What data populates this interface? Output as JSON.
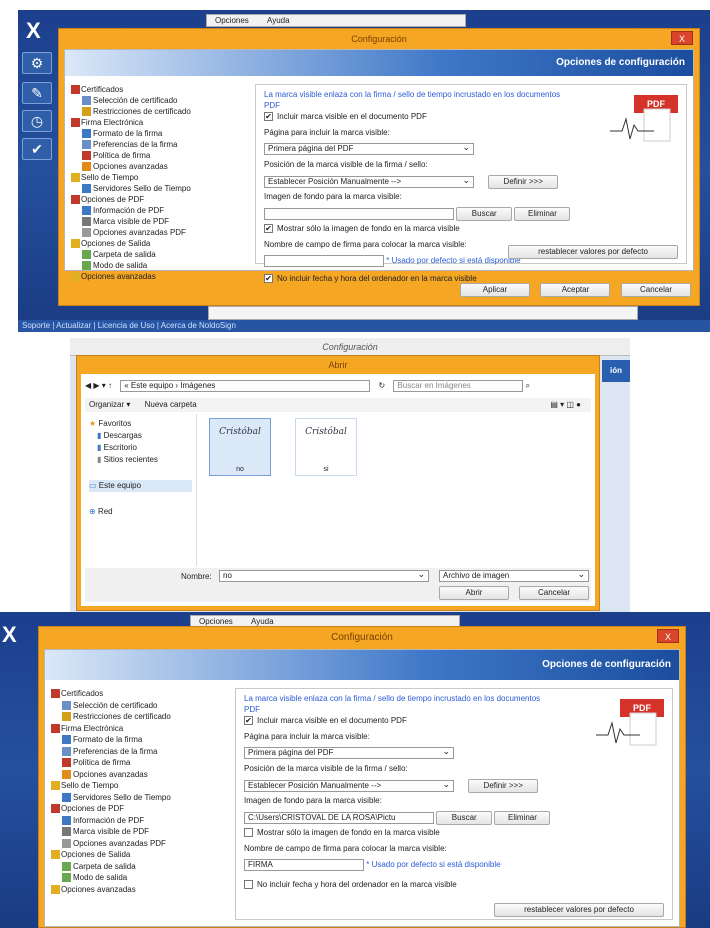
{
  "panel1": {
    "menu": [
      "Opciones",
      "Ayuda"
    ],
    "app_logo": "X",
    "dialog_title": "Configuración",
    "close_label": "X",
    "banner": "Opciones de configuración",
    "tree": [
      {
        "label": "Certificados",
        "level": 0,
        "icon": "certificate-icon",
        "color": "#c0392b"
      },
      {
        "label": "Selección de certificado",
        "level": 1,
        "icon": "magnifier-icon",
        "color": "#6a8fc7"
      },
      {
        "label": "Restricciones de certificado",
        "level": 1,
        "icon": "restriction-icon",
        "color": "#d4a017"
      },
      {
        "label": "Firma Electrónica",
        "level": 0,
        "icon": "pen-icon",
        "color": "#c0392b"
      },
      {
        "label": "Formato de la firma",
        "level": 1,
        "icon": "format-icon",
        "color": "#3c78c3"
      },
      {
        "label": "Preferencias de la firma",
        "level": 1,
        "icon": "preferences-icon",
        "color": "#6a8fc7"
      },
      {
        "label": "Política de firma",
        "level": 1,
        "icon": "policy-icon",
        "color": "#c0392b"
      },
      {
        "label": "Opciones avanzadas",
        "level": 1,
        "icon": "advanced-icon",
        "color": "#e08b1a"
      },
      {
        "label": "Sello de Tiempo",
        "level": 0,
        "icon": "clock-icon",
        "color": "#e0b020"
      },
      {
        "label": "Servidores Sello de Tiempo",
        "level": 1,
        "icon": "server-icon",
        "color": "#3c78c3"
      },
      {
        "label": "Opciones de PDF",
        "level": 0,
        "icon": "pdf-icon",
        "color": "#c0392b"
      },
      {
        "label": "Información de PDF",
        "level": 1,
        "icon": "info-icon",
        "color": "#3c78c3"
      },
      {
        "label": "Marca visible de PDF",
        "level": 1,
        "icon": "mark-icon",
        "color": "#777777"
      },
      {
        "label": "Opciones avanzadas PDF",
        "level": 1,
        "icon": "advanced-icon",
        "color": "#999999"
      },
      {
        "label": "Opciones de Salida",
        "level": 0,
        "icon": "output-icon",
        "color": "#e0b020"
      },
      {
        "label": "Carpeta de salida",
        "level": 1,
        "icon": "folder-icon",
        "color": "#6aa84f"
      },
      {
        "label": "Modo de salida",
        "level": 1,
        "icon": "mode-icon",
        "color": "#6aa84f"
      },
      {
        "label": "Opciones avanzadas",
        "level": 0,
        "icon": "advanced-icon",
        "color": "#e0b020"
      }
    ],
    "form": {
      "intro": "La marca visible enlaza con la firma / sello de tiempo incrustado en los documentos PDF",
      "include_mark": "Incluir marca visible en el documento PDF",
      "page_label": "Página para incluir la marca visible:",
      "page_value": "Primera página del PDF",
      "position_label": "Posición de la marca visible de la firma / sello:",
      "position_value": "Establecer Posición Manualmente -->",
      "define_button": "Definir >>>",
      "bg_label": "Imagen de fondo para la marca visible:",
      "bg_value": "",
      "buscar": "Buscar",
      "eliminar": "Eliminar",
      "only_bg": "Mostrar sólo la imagen de fondo en la marca visible",
      "field_label": "Nombre de campo de firma para colocar la marca visible:",
      "field_value": "",
      "field_hint": "* Usado por defecto si está disponible",
      "no_date": "No incluir fecha y hora del ordenador en la marca visible",
      "reset": "restablecer valores por defecto",
      "aplicar": "Aplicar",
      "aceptar": "Aceptar",
      "cancelar": "Cancelar",
      "pdf_badge": "PDF"
    },
    "statusbar": "Soporte  |  Actualizar  |  Licencia de Uso  |  Acerca de NoldoSign"
  },
  "panel2": {
    "bg_title": "Configuración",
    "title": "Abrir",
    "breadcrumb": "« Este equipo › Imágenes",
    "search_placeholder": "Buscar en Imágenes",
    "organize": "Organizar ▾",
    "new_folder": "Nueva carpeta",
    "nav": [
      "Favoritos",
      "Descargas",
      "Escritorio",
      "Sitios recientes",
      "Este equipo",
      "Red"
    ],
    "files": [
      {
        "name": "no",
        "signature": "Cristóbal"
      },
      {
        "name": "si",
        "signature": "Cristóbal"
      }
    ],
    "filename_label": "Nombre:",
    "filename_value": "no",
    "filetype": "Archivo de imagen",
    "open": "Abrir",
    "cancel": "Cancelar",
    "side_text": "ión"
  },
  "panel3": {
    "menu": [
      "Opciones",
      "Ayuda"
    ],
    "dialog_title": "Configuración",
    "banner": "Opciones de configuración",
    "form": {
      "intro": "La marca visible enlaza con la firma / sello de tiempo incrustado en los documentos PDF",
      "include_mark": "Incluir marca visible en el documento PDF",
      "page_label": "Página para incluir la marca visible:",
      "page_value": "Primera página del PDF",
      "position_label": "Posición de la marca visible de la firma / sello:",
      "position_value": "Establecer Posición Manualmente -->",
      "define_button": "Definir >>>",
      "bg_label": "Imagen de fondo para la marca visible:",
      "bg_value": "C:\\Users\\CRISTOVAL DE LA ROSA\\Pictu",
      "buscar": "Buscar",
      "eliminar": "Eliminar",
      "only_bg": "Mostrar sólo la imagen de fondo en la marca visible",
      "field_label": "Nombre de campo de firma para colocar la marca visible:",
      "field_value": "FIRMA",
      "field_hint": "* Usado por defecto si está disponible",
      "no_date": "No incluir fecha y hora del ordenador en la marca visible",
      "reset": "restablecer valores por defecto",
      "pdf_badge": "PDF"
    }
  }
}
